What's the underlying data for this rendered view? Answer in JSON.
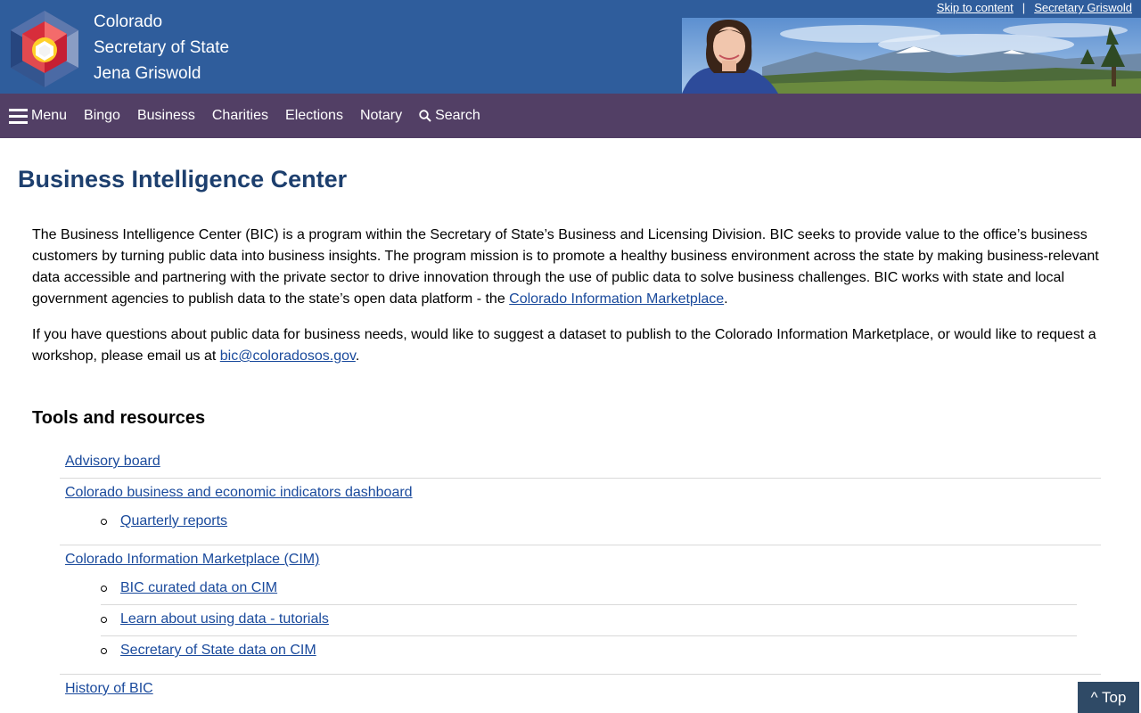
{
  "header": {
    "title_lines": [
      "Colorado",
      "Secretary of State",
      "Jena Griswold"
    ],
    "skip_link": "Skip to content",
    "separator": "|",
    "official_link": "Secretary Griswold"
  },
  "nav": {
    "menu": "Menu",
    "items": [
      "Bingo",
      "Business",
      "Charities",
      "Elections",
      "Notary"
    ],
    "search": "Search"
  },
  "main": {
    "title": "Business Intelligence Center",
    "para1_text": "The Business Intelligence Center (BIC) is a program within the Secretary of State’s Business and Licensing Division. BIC seeks to provide value to the office’s business customers by turning public data into business insights. The program mission is to promote a healthy business environment across the state by making business-relevant data accessible and partnering with the private sector to drive innovation through the use of public data to solve business challenges. BIC works with state and local government agencies to publish data to the state’s open data platform - the ",
    "para1_link": "Colorado Information Marketplace",
    "para1_end": ".",
    "para2_text": "If you have questions about public data for business needs, would like to suggest a dataset to publish to the Colorado Information Marketplace, or would like to request a workshop, please email us at ",
    "para2_link": "bic@coloradosos.gov",
    "para2_end": ".",
    "tools_title": "Tools and resources",
    "resources": [
      {
        "label": "Advisory board",
        "children": []
      },
      {
        "label": "Colorado business and economic indicators dashboard",
        "children": [
          "Quarterly reports"
        ]
      },
      {
        "label": "Colorado Information Marketplace (CIM)",
        "children": [
          "BIC curated data on CIM",
          "Learn about using data - tutorials",
          "Secretary of State data on CIM"
        ]
      },
      {
        "label": "History of BIC",
        "children": []
      }
    ]
  },
  "top_button": "^ Top",
  "colors": {
    "header_bg": "#2f5d9c",
    "nav_bg": "#523f65",
    "title": "#1d3f6e",
    "link": "#1a4a9c",
    "top_button_bg": "#2f4a66"
  },
  "icons": [
    "colorado-seal-logo-icon",
    "hamburger-menu-icon",
    "search-icon",
    "secretary-portrait-mountains-banner"
  ]
}
